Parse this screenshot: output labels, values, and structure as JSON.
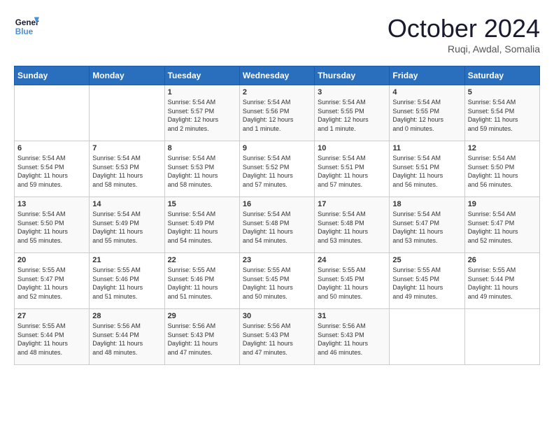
{
  "header": {
    "logo_line1": "General",
    "logo_line2": "Blue",
    "month": "October 2024",
    "location": "Ruqi, Awdal, Somalia"
  },
  "weekdays": [
    "Sunday",
    "Monday",
    "Tuesday",
    "Wednesday",
    "Thursday",
    "Friday",
    "Saturday"
  ],
  "weeks": [
    [
      {
        "day": "",
        "info": ""
      },
      {
        "day": "",
        "info": ""
      },
      {
        "day": "1",
        "info": "Sunrise: 5:54 AM\nSunset: 5:57 PM\nDaylight: 12 hours\nand 2 minutes."
      },
      {
        "day": "2",
        "info": "Sunrise: 5:54 AM\nSunset: 5:56 PM\nDaylight: 12 hours\nand 1 minute."
      },
      {
        "day": "3",
        "info": "Sunrise: 5:54 AM\nSunset: 5:55 PM\nDaylight: 12 hours\nand 1 minute."
      },
      {
        "day": "4",
        "info": "Sunrise: 5:54 AM\nSunset: 5:55 PM\nDaylight: 12 hours\nand 0 minutes."
      },
      {
        "day": "5",
        "info": "Sunrise: 5:54 AM\nSunset: 5:54 PM\nDaylight: 11 hours\nand 59 minutes."
      }
    ],
    [
      {
        "day": "6",
        "info": "Sunrise: 5:54 AM\nSunset: 5:54 PM\nDaylight: 11 hours\nand 59 minutes."
      },
      {
        "day": "7",
        "info": "Sunrise: 5:54 AM\nSunset: 5:53 PM\nDaylight: 11 hours\nand 58 minutes."
      },
      {
        "day": "8",
        "info": "Sunrise: 5:54 AM\nSunset: 5:53 PM\nDaylight: 11 hours\nand 58 minutes."
      },
      {
        "day": "9",
        "info": "Sunrise: 5:54 AM\nSunset: 5:52 PM\nDaylight: 11 hours\nand 57 minutes."
      },
      {
        "day": "10",
        "info": "Sunrise: 5:54 AM\nSunset: 5:51 PM\nDaylight: 11 hours\nand 57 minutes."
      },
      {
        "day": "11",
        "info": "Sunrise: 5:54 AM\nSunset: 5:51 PM\nDaylight: 11 hours\nand 56 minutes."
      },
      {
        "day": "12",
        "info": "Sunrise: 5:54 AM\nSunset: 5:50 PM\nDaylight: 11 hours\nand 56 minutes."
      }
    ],
    [
      {
        "day": "13",
        "info": "Sunrise: 5:54 AM\nSunset: 5:50 PM\nDaylight: 11 hours\nand 55 minutes."
      },
      {
        "day": "14",
        "info": "Sunrise: 5:54 AM\nSunset: 5:49 PM\nDaylight: 11 hours\nand 55 minutes."
      },
      {
        "day": "15",
        "info": "Sunrise: 5:54 AM\nSunset: 5:49 PM\nDaylight: 11 hours\nand 54 minutes."
      },
      {
        "day": "16",
        "info": "Sunrise: 5:54 AM\nSunset: 5:48 PM\nDaylight: 11 hours\nand 54 minutes."
      },
      {
        "day": "17",
        "info": "Sunrise: 5:54 AM\nSunset: 5:48 PM\nDaylight: 11 hours\nand 53 minutes."
      },
      {
        "day": "18",
        "info": "Sunrise: 5:54 AM\nSunset: 5:47 PM\nDaylight: 11 hours\nand 53 minutes."
      },
      {
        "day": "19",
        "info": "Sunrise: 5:54 AM\nSunset: 5:47 PM\nDaylight: 11 hours\nand 52 minutes."
      }
    ],
    [
      {
        "day": "20",
        "info": "Sunrise: 5:55 AM\nSunset: 5:47 PM\nDaylight: 11 hours\nand 52 minutes."
      },
      {
        "day": "21",
        "info": "Sunrise: 5:55 AM\nSunset: 5:46 PM\nDaylight: 11 hours\nand 51 minutes."
      },
      {
        "day": "22",
        "info": "Sunrise: 5:55 AM\nSunset: 5:46 PM\nDaylight: 11 hours\nand 51 minutes."
      },
      {
        "day": "23",
        "info": "Sunrise: 5:55 AM\nSunset: 5:45 PM\nDaylight: 11 hours\nand 50 minutes."
      },
      {
        "day": "24",
        "info": "Sunrise: 5:55 AM\nSunset: 5:45 PM\nDaylight: 11 hours\nand 50 minutes."
      },
      {
        "day": "25",
        "info": "Sunrise: 5:55 AM\nSunset: 5:45 PM\nDaylight: 11 hours\nand 49 minutes."
      },
      {
        "day": "26",
        "info": "Sunrise: 5:55 AM\nSunset: 5:44 PM\nDaylight: 11 hours\nand 49 minutes."
      }
    ],
    [
      {
        "day": "27",
        "info": "Sunrise: 5:55 AM\nSunset: 5:44 PM\nDaylight: 11 hours\nand 48 minutes."
      },
      {
        "day": "28",
        "info": "Sunrise: 5:56 AM\nSunset: 5:44 PM\nDaylight: 11 hours\nand 48 minutes."
      },
      {
        "day": "29",
        "info": "Sunrise: 5:56 AM\nSunset: 5:43 PM\nDaylight: 11 hours\nand 47 minutes."
      },
      {
        "day": "30",
        "info": "Sunrise: 5:56 AM\nSunset: 5:43 PM\nDaylight: 11 hours\nand 47 minutes."
      },
      {
        "day": "31",
        "info": "Sunrise: 5:56 AM\nSunset: 5:43 PM\nDaylight: 11 hours\nand 46 minutes."
      },
      {
        "day": "",
        "info": ""
      },
      {
        "day": "",
        "info": ""
      }
    ]
  ]
}
